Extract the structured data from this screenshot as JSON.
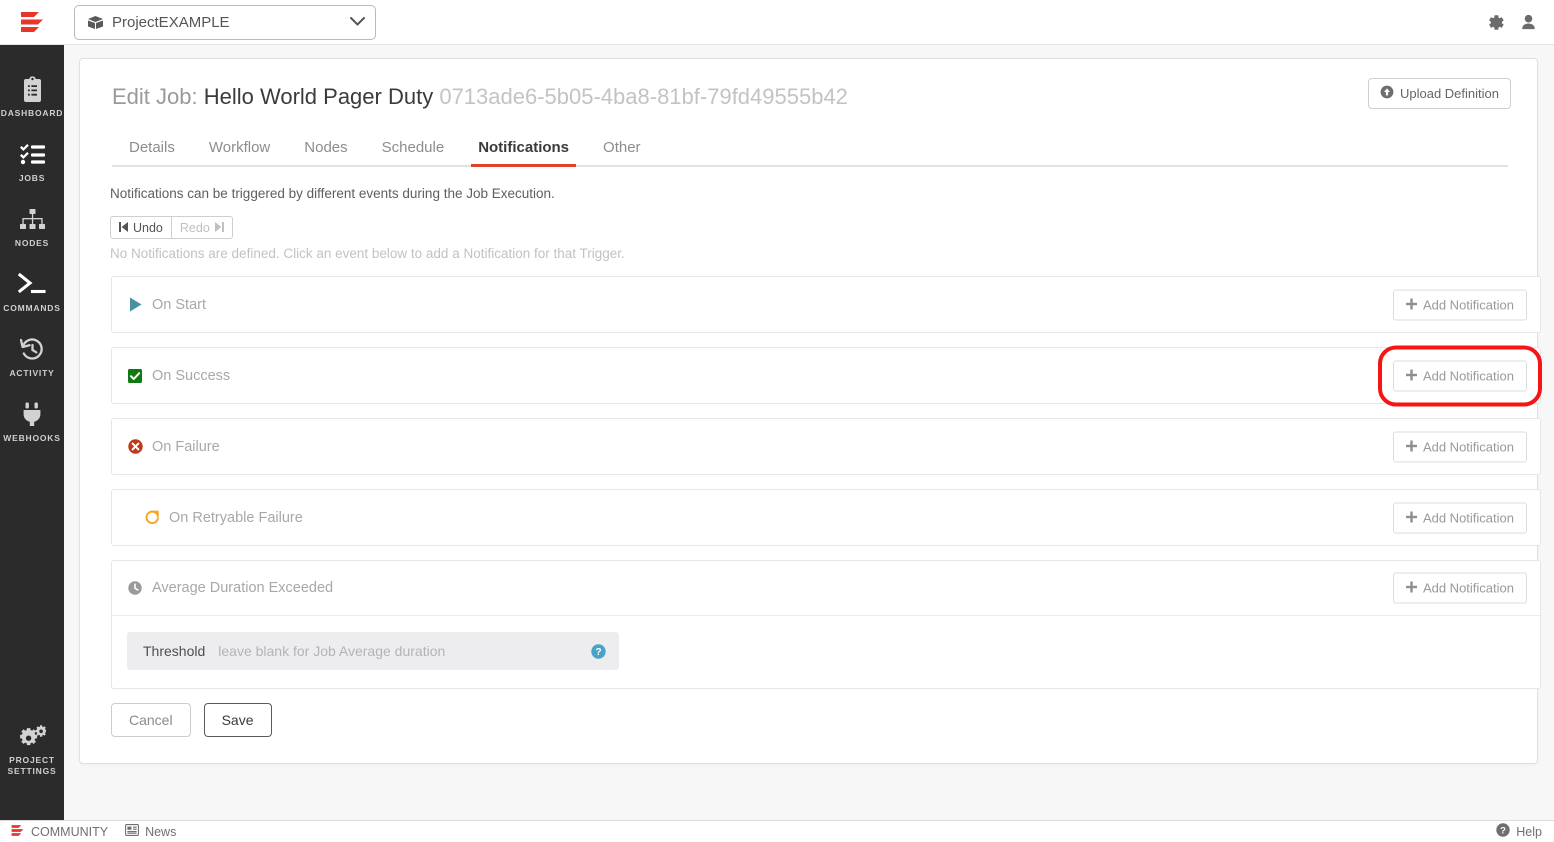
{
  "topbar": {
    "logo_icon": "rundeck-logo-icon",
    "project_selector": {
      "icon": "package-icon",
      "value": "ProjectEXAMPLE",
      "chevron_icon": "chevron-down-icon"
    },
    "settings_icon": "gear-icon",
    "user_icon": "user-icon"
  },
  "sidebar": {
    "items": [
      {
        "label": "DASHBOARD",
        "icon": "clipboard-icon"
      },
      {
        "label": "JOBS",
        "icon": "checklist-icon"
      },
      {
        "label": "NODES",
        "icon": "sitemap-icon"
      },
      {
        "label": "COMMANDS",
        "icon": "terminal-icon"
      },
      {
        "label": "ACTIVITY",
        "icon": "history-clock-icon"
      },
      {
        "label": "WEBHOOKS",
        "icon": "plug-icon"
      }
    ],
    "bottom_item": {
      "label": "PROJECT\nSETTINGS",
      "label_line1": "PROJECT",
      "label_line2": "SETTINGS",
      "icon": "gears-icon"
    }
  },
  "page": {
    "title_prefix": "Edit Job:",
    "title_name": "Hello World Pager Duty",
    "title_uuid": "0713ade6-5b05-4ba8-81bf-79fd49555b42",
    "upload_button": {
      "label": "Upload Definition",
      "icon": "upload-circle-icon"
    }
  },
  "tabs": [
    {
      "label": "Details",
      "active": false
    },
    {
      "label": "Workflow",
      "active": false
    },
    {
      "label": "Nodes",
      "active": false
    },
    {
      "label": "Schedule",
      "active": false
    },
    {
      "label": "Notifications",
      "active": true
    },
    {
      "label": "Other",
      "active": false
    }
  ],
  "notifications": {
    "description": "Notifications can be triggered by different events during the Job Execution.",
    "undo_label": "Undo",
    "redo_label": "Redo",
    "undo_icon": "step-backward-icon",
    "redo_icon": "step-forward-icon",
    "empty_message": "No Notifications are defined. Click an event below to add a Notification for that Trigger.",
    "add_label": "Add Notification",
    "add_icon": "plus-icon",
    "rows": [
      {
        "label": "On Start",
        "icon": "play-triangle-icon",
        "icon_color": "#4a90a4",
        "highlighted": false
      },
      {
        "label": "On Success",
        "icon": "check-square-icon",
        "icon_color": "#107a10",
        "highlighted": true
      },
      {
        "label": "On Failure",
        "icon": "times-circle-icon",
        "icon_color": "#c0391b",
        "highlighted": false
      },
      {
        "label": "On Retryable Failure",
        "icon": "redo-arrow-icon",
        "icon_color": "#f5a623",
        "highlighted": false
      },
      {
        "label": "Average Duration Exceeded",
        "icon": "clock-icon",
        "icon_color": "#9a9a9a",
        "highlighted": false
      }
    ],
    "threshold": {
      "label": "Threshold",
      "placeholder": "leave blank for Job Average duration",
      "value": "",
      "help_icon": "question-circle-icon"
    }
  },
  "form_actions": {
    "cancel_label": "Cancel",
    "save_label": "Save"
  },
  "bottombar": {
    "community_label": "COMMUNITY",
    "community_icon": "rundeck-logo-icon",
    "news_label": "News",
    "news_icon": "newspaper-icon",
    "help_label": "Help",
    "help_icon": "question-circle-icon"
  },
  "colors": {
    "brand_red": "#e2412a",
    "highlight_red": "#f71414",
    "sidebar_bg": "#2b2b2b",
    "page_bg": "#f7f7f7"
  }
}
